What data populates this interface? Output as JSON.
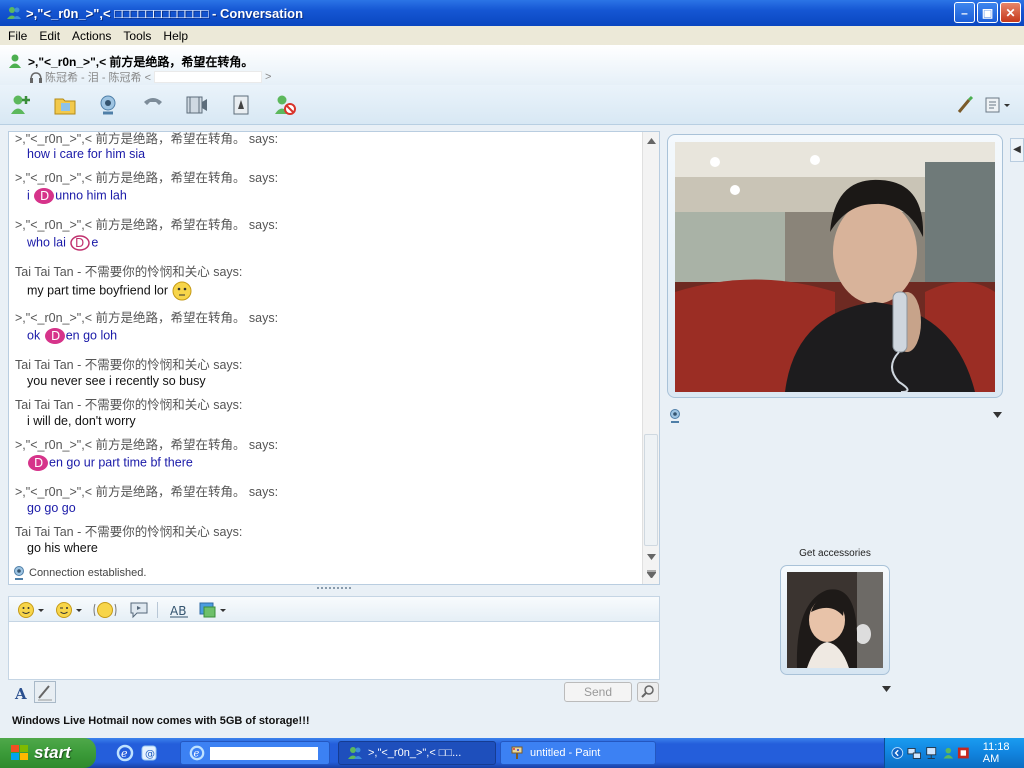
{
  "window": {
    "title": ">,\"<_r0n_>\",< □□□□□□□□□□□□ - Conversation",
    "minimize": "–",
    "maximize": "▣",
    "close": "✕"
  },
  "menu": [
    "File",
    "Edit",
    "Actions",
    "Tools",
    "Help"
  ],
  "contact": {
    "name": ">,\"<_r0n_>\",<  前方是绝路，希望在转角。",
    "sub": "陈冠希 - 泪 - 陈冠希 <",
    "sub_end": ">"
  },
  "messages": [
    {
      "sender": ">,\"<_r0n_>\",<  前方是绝路，希望在转角。 says:",
      "text_pre": "how i care for him sia",
      "text_post": "",
      "emoticon": "",
      "style": "blue"
    },
    {
      "sender": ">,\"<_r0n_>\",<  前方是绝路，希望在转角。 says:",
      "text_pre": "i ",
      "text_post": "unno him lah",
      "emoticon": "custom-d-emoticon",
      "style": "blue"
    },
    {
      "sender": ">,\"<_r0n_>\",<  前方是绝路，希望在转角。 says:",
      "text_pre": "who lai ",
      "text_post": "e",
      "emoticon": "custom-d-outline-emoticon",
      "style": "blue"
    },
    {
      "sender": "Tai Tai Tan - 不需要你的怜悯和关心 says:",
      "text_pre": "my part time boyfriend lor ",
      "text_post": "",
      "emoticon": "thinking-face-emoticon",
      "style": "dark"
    },
    {
      "sender": ">,\"<_r0n_>\",<  前方是绝路，希望在转角。 says:",
      "text_pre": "ok ",
      "text_post": "en go loh",
      "emoticon": "custom-d-emoticon",
      "style": "blue"
    },
    {
      "sender": "Tai Tai Tan - 不需要你的怜悯和关心 says:",
      "text_pre": "you never see i recently so busy",
      "text_post": "",
      "emoticon": "",
      "style": "dark"
    },
    {
      "sender": "Tai Tai Tan - 不需要你的怜悯和关心 says:",
      "text_pre": "i will de, don't worry",
      "text_post": "",
      "emoticon": "",
      "style": "dark"
    },
    {
      "sender": ">,\"<_r0n_>\",<  前方是绝路，希望在转角。 says:",
      "text_pre": "",
      "text_post": "en go ur part time bf there",
      "emoticon": "custom-d-emoticon",
      "style": "blue"
    },
    {
      "sender": ">,\"<_r0n_>\",<  前方是绝路，希望在转角。 says:",
      "text_pre": "go go go",
      "text_post": "",
      "emoticon": "",
      "style": "blue"
    },
    {
      "sender": "Tai Tai Tan - 不需要你的怜悯和关心 says:",
      "text_pre": "go his where",
      "text_post": "",
      "emoticon": "",
      "style": "dark"
    }
  ],
  "partial_top_sender": ">,\"<_r0n_>\",<  前方是绝路，希望在转角。 says:",
  "status": "Connection established.",
  "compose": {
    "value": "",
    "send_label": "Send"
  },
  "ad": "Windows Live Hotmail now comes with 5GB of storage!!!",
  "right_pane": {
    "accessories": "Get accessories"
  },
  "taskbar": {
    "start": "start",
    "tasks": [
      {
        "label": "",
        "icon": "ie-icon"
      },
      {
        "label": ">,\"<_r0n_>\",< □□...",
        "icon": "messenger-icon"
      },
      {
        "label": "untitled - Paint",
        "icon": "paint-icon"
      }
    ],
    "clock": "11:18 AM"
  }
}
